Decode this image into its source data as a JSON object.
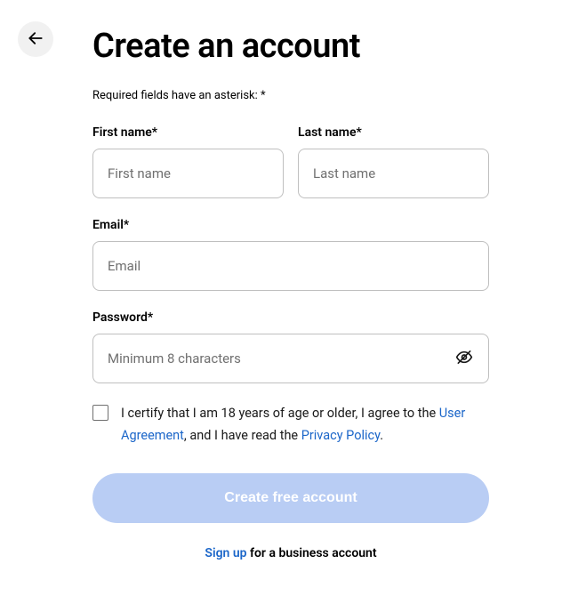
{
  "title": "Create an account",
  "required_note": "Required fields have an asterisk: *",
  "fields": {
    "first_name": {
      "label": "First name*",
      "placeholder": "First name"
    },
    "last_name": {
      "label": "Last name*",
      "placeholder": "Last name"
    },
    "email": {
      "label": "Email*",
      "placeholder": "Email"
    },
    "password": {
      "label": "Password*",
      "placeholder": "Minimum 8 characters"
    }
  },
  "consent": {
    "part1": "I certify that I am 18 years of age or older, I agree to the ",
    "user_agreement": "User Agreement",
    "part2": ", and I have read the ",
    "privacy_policy": "Privacy Policy",
    "part3": "."
  },
  "submit_label": "Create free account",
  "footer": {
    "signup_link": "Sign up",
    "rest": " for a business account"
  }
}
